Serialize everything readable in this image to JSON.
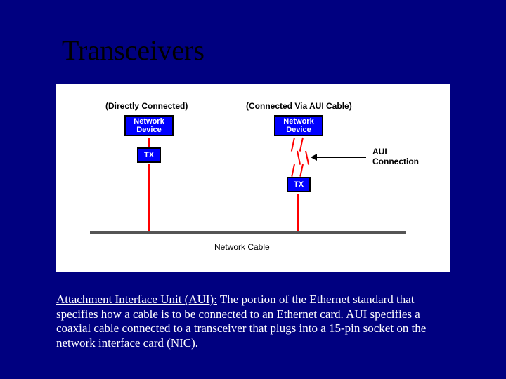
{
  "title": "Transceivers",
  "diagram": {
    "left_header": "(Directly Connected)",
    "right_header": "(Connected Via AUI Cable)",
    "network_device_label": "Network\nDevice",
    "tx_label": "TX",
    "aui_annotation_line1": "AUI",
    "aui_annotation_line2": "Connection",
    "cable_label": "Network Cable"
  },
  "paragraph": {
    "term": "Attachment Interface Unit (AUI):",
    "body": " The portion of the Ethernet standard that specifies how a cable is to be connected to an Ethernet card.  AUI specifies a coaxial cable connected to a transceiver that plugs into a 15-pin socket on the network interface card (NIC)."
  }
}
